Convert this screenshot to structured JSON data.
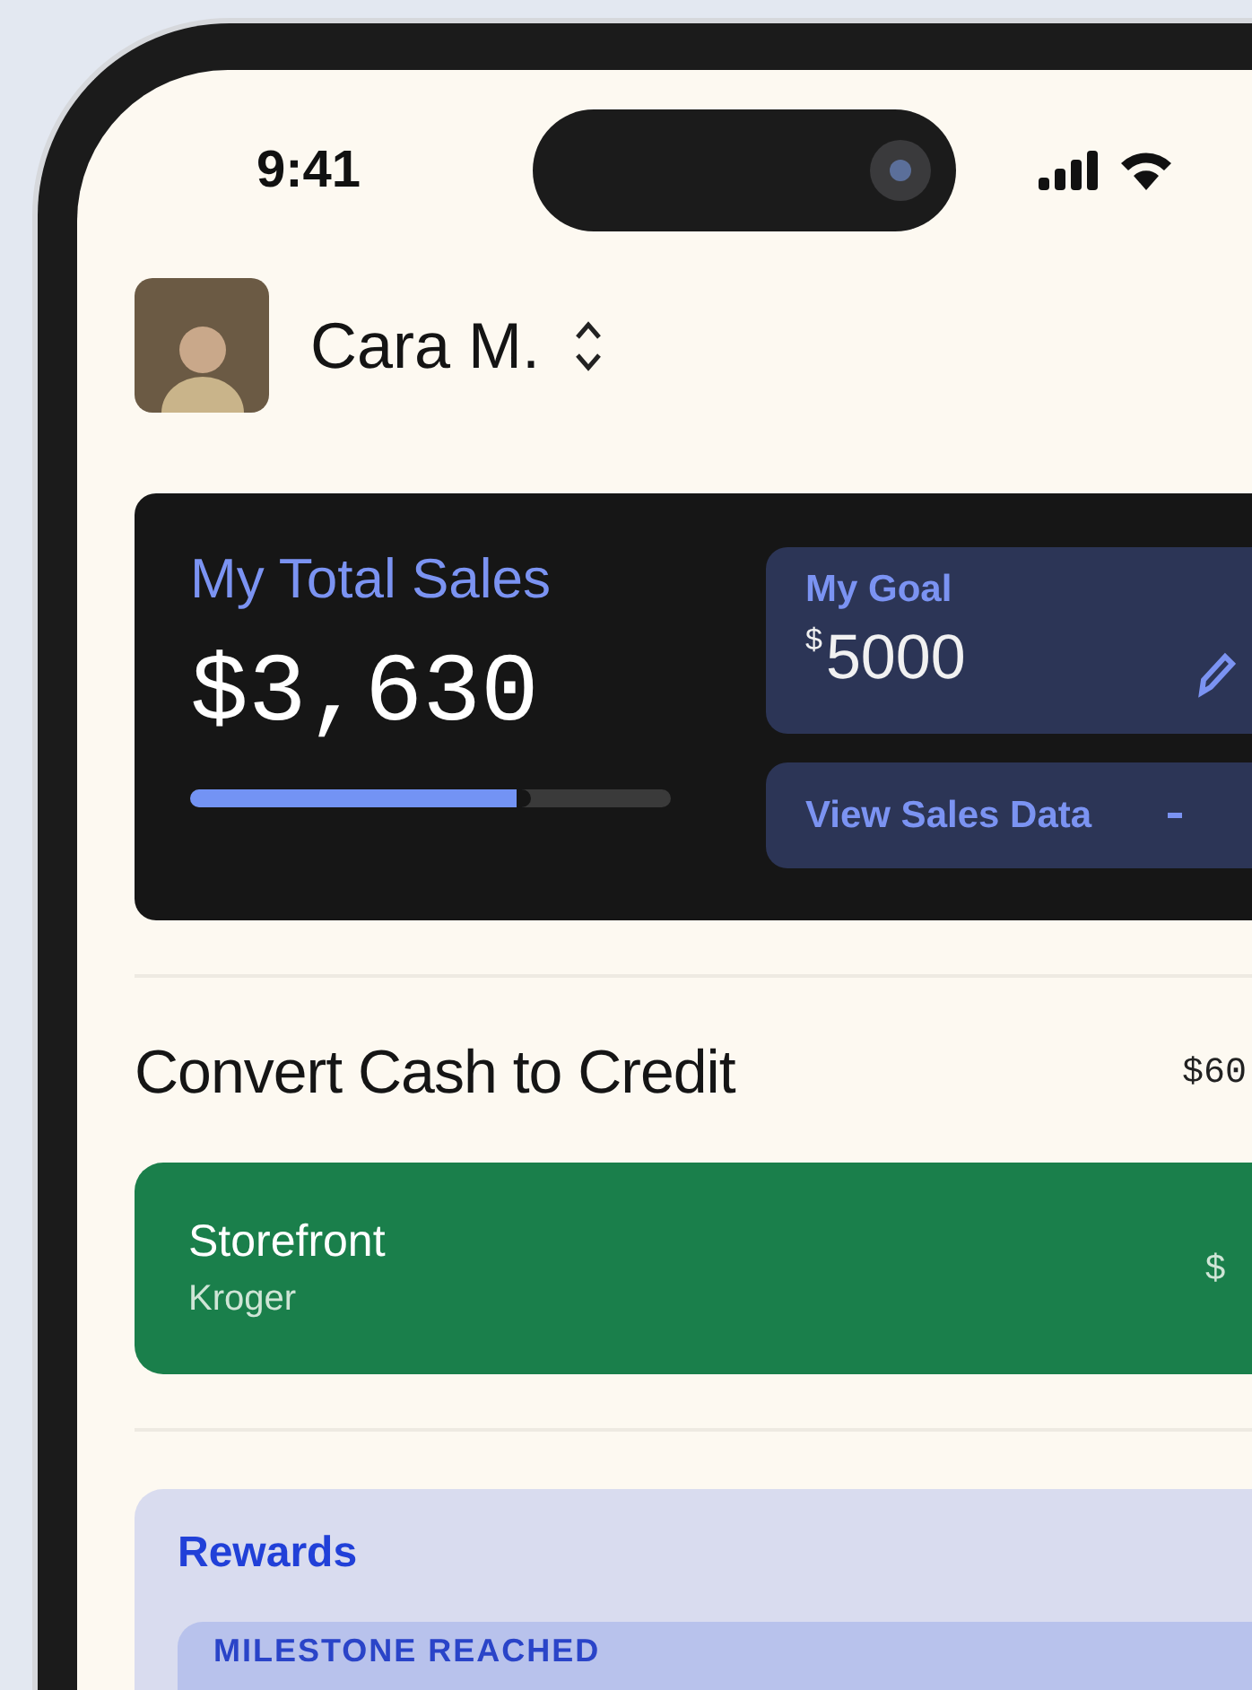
{
  "status_bar": {
    "time": "9:41"
  },
  "profile": {
    "name": "Cara M."
  },
  "sales_card": {
    "title": "My Total Sales",
    "amount": "$3,630",
    "level": 0.71,
    "goal": {
      "label": "My Goal",
      "currency": "$",
      "amount": "5000"
    },
    "view_button": {
      "label": "View Sales Data"
    }
  },
  "convert": {
    "title": "Convert Cash to Credit",
    "amount": "$60",
    "options": [
      {
        "name": "Storefront",
        "store": "Kroger",
        "price": "$"
      }
    ]
  },
  "rewards": {
    "title": "Rewards",
    "milestone": "MILESTONE REACHED"
  }
}
